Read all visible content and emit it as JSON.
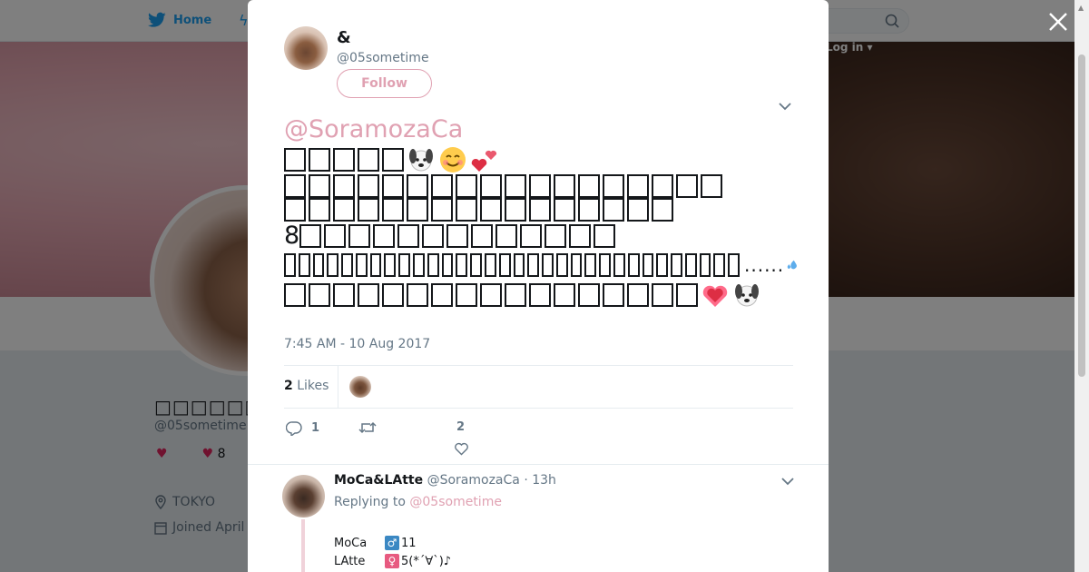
{
  "background": {
    "nav": {
      "home_label": "Home",
      "login_label": "Log in"
    },
    "profile": {
      "name": "□□□□□□□□□□",
      "handle": "@05sometime",
      "likes_count": "8",
      "location": "TOKYO",
      "joined": "Joined April"
    }
  },
  "tweet": {
    "author_name": "&",
    "author_handle": "@05sometime",
    "follow_label": "Follow",
    "mention": "@SoramozaCa",
    "line2_count": "8",
    "dots": "......",
    "timestamp": "7:45 AM - 10 Aug 2017",
    "likes_number": "2",
    "likes_word": "Likes",
    "reply_count": "1",
    "retweet_count": "",
    "like_count": "2"
  },
  "reply": {
    "name": "MoCa&LAtte",
    "handle": "@SoramozaCa",
    "time": "· 13h",
    "replying_prefix": "Replying to",
    "replying_to": "@05sometime",
    "line1_label": "MoCa",
    "line1_value": "11",
    "line1_symbol": "♂",
    "line2_label": "LAtte",
    "line2_value": "5(*´∀`)♪",
    "line2_symbol": "♀"
  },
  "colors": {
    "accent_pink": "#e0a1b2",
    "twitter_blue": "#1da1f2",
    "male_blue": "#3b88c3",
    "female_pink": "#e75a80"
  },
  "icons": [
    "twitter-bird-icon",
    "search-icon",
    "close-icon",
    "chevron-down-icon",
    "reply-icon",
    "retweet-icon",
    "heart-icon",
    "location-icon",
    "calendar-icon"
  ]
}
